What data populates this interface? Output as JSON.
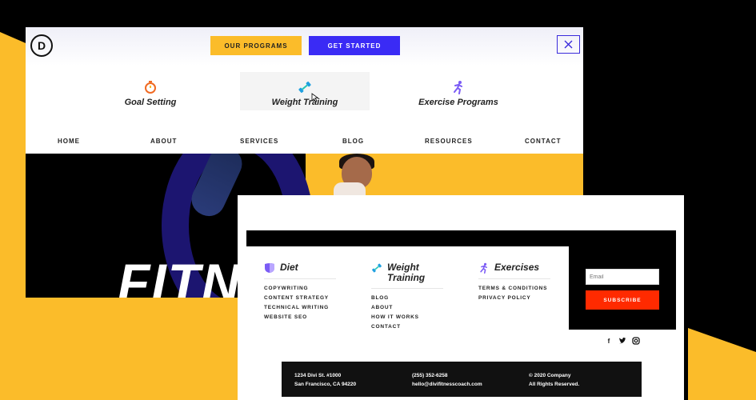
{
  "header": {
    "logo_letter": "D",
    "buttons": {
      "programs": "OUR PROGRAMS",
      "started": "GET STARTED"
    },
    "close_symbol": "✕",
    "mega_menu": [
      {
        "label": "Goal Setting",
        "icon": "stopwatch-icon"
      },
      {
        "label": "Weight Training",
        "icon": "dumbbell-icon"
      },
      {
        "label": "Exercise Programs",
        "icon": "runner-icon"
      }
    ],
    "nav": [
      "HOME",
      "ABOUT",
      "SERVICES",
      "BLOG",
      "RESOURCES",
      "CONTACT"
    ]
  },
  "hero": {
    "title": "FITN"
  },
  "footer": {
    "columns": [
      {
        "title": "Diet",
        "icon": "shield-icon",
        "links": [
          "COPYWRITING",
          "CONTENT STRATEGY",
          "TECHNICAL WRITING",
          "WEBSITE SEO"
        ]
      },
      {
        "title_line1": "Weight",
        "title_line2": "Training",
        "icon": "dumbbell-icon",
        "links": [
          "BLOG",
          "ABOUT",
          "HOW IT WORKS",
          "CONTACT"
        ]
      },
      {
        "title": "Exercises",
        "icon": "runner-icon",
        "links": [
          "TERMS & CONDITIONS",
          "PRIVACY POLICY"
        ]
      }
    ],
    "email_placeholder": "Email",
    "subscribe_label": "SUBSCRIBE",
    "social": {
      "facebook": "f",
      "twitter": "t",
      "instagram": "◎"
    },
    "bottom": {
      "address_1": "1234 Divi St. #1000",
      "address_2": "San Francisco, CA 94220",
      "phone": "(255) 352-6258",
      "email": "hello@divifitnesscoach.com",
      "copyright": "© 2020 Company",
      "rights": "All Rights Reserved."
    }
  },
  "colors": {
    "yellow": "#fbbc2a",
    "blue": "#3a2bf5",
    "red": "#ff2a00",
    "purple": "#7b5cf5"
  }
}
